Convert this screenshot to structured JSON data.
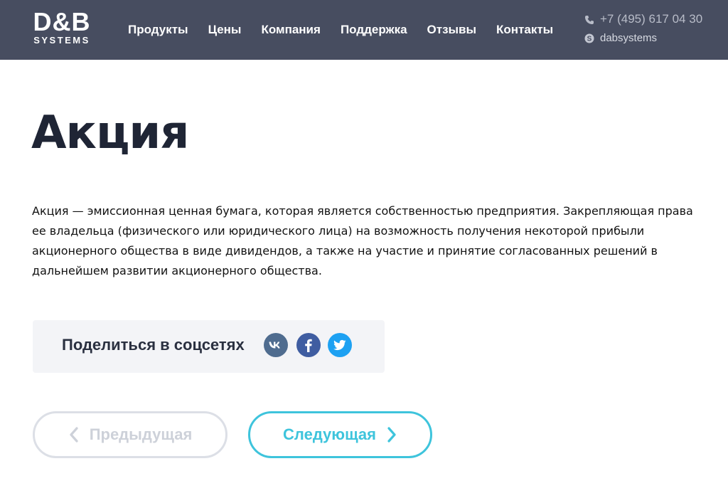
{
  "logo": {
    "main": "D&B",
    "sub": "SYSTEMS"
  },
  "nav": {
    "items": [
      {
        "label": "Продукты"
      },
      {
        "label": "Цены"
      },
      {
        "label": "Компания"
      },
      {
        "label": "Поддержка"
      },
      {
        "label": "Отзывы"
      },
      {
        "label": "Контакты"
      }
    ]
  },
  "contacts": {
    "phone": "+7 (495) 617 04 30",
    "skype": "dabsystems",
    "phone_icon": "phone-icon",
    "skype_icon": "skype-icon"
  },
  "article": {
    "title": "Акция",
    "lines": [
      "Акция — эмиссионная ценная бумага, которая является собственностью предприятия. Закрепляющая права",
      "ее владельца (физического или юридического лица) на возможность получения некоторой прибыли",
      "акционерного общества в виде дивидендов, а также на участие и принятие согласованных решений в",
      "дальнейшем развитии акционерного общества."
    ]
  },
  "share": {
    "label": "Поделиться в соцсетях",
    "networks": [
      {
        "icon": "vk-icon",
        "color": "#4f6c8f"
      },
      {
        "icon": "facebook-icon",
        "color": "#3f5da1"
      },
      {
        "icon": "twitter-icon",
        "color": "#1da1f2"
      }
    ]
  },
  "pagination": {
    "prev_label": "Предыдущая",
    "next_label": "Следующая",
    "accent": "#3ec4dc",
    "disabled": "#cdd1d9"
  },
  "colors": {
    "header_bg": "#474d60",
    "share_bg": "#f3f4f7"
  }
}
